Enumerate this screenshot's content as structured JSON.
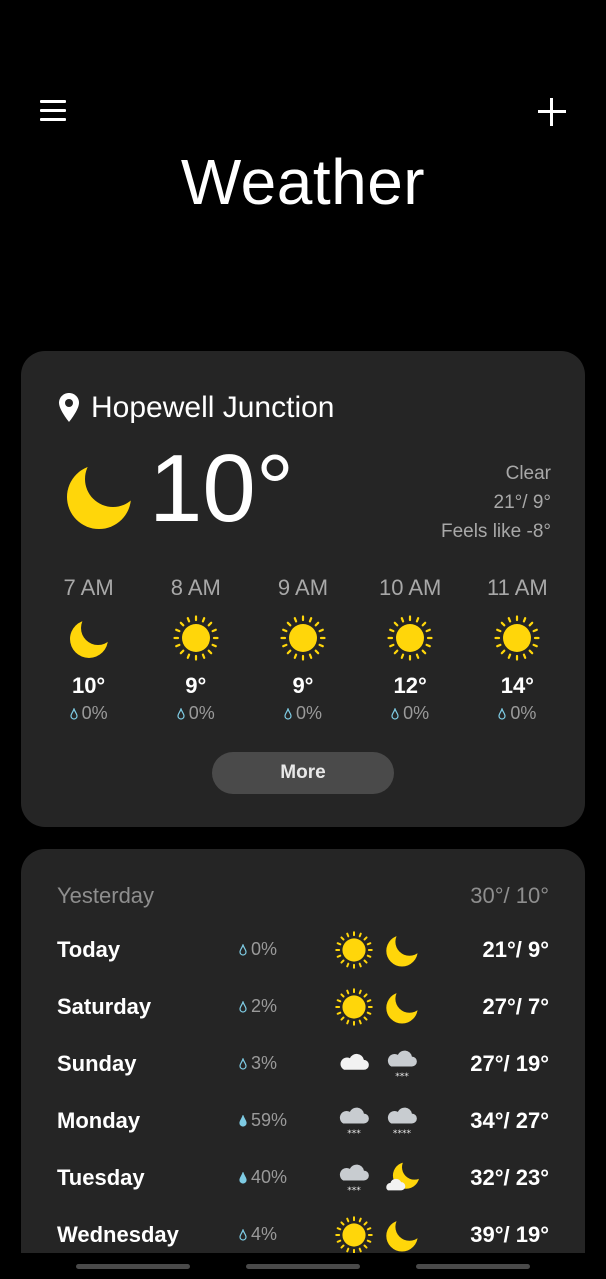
{
  "app": {
    "title": "Weather"
  },
  "current": {
    "location": "Hopewell Junction",
    "temp": "10°",
    "condition": "Clear",
    "high_low": "21°/ 9°",
    "feels_like": "Feels like -8°"
  },
  "hourly": [
    {
      "time": "7 AM",
      "icon": "moon-icon",
      "temp": "10°",
      "precip": "0%"
    },
    {
      "time": "8 AM",
      "icon": "sun-icon",
      "temp": "9°",
      "precip": "0%"
    },
    {
      "time": "9 AM",
      "icon": "sun-icon",
      "temp": "9°",
      "precip": "0%"
    },
    {
      "time": "10 AM",
      "icon": "sun-icon",
      "temp": "12°",
      "precip": "0%"
    },
    {
      "time": "11 AM",
      "icon": "sun-icon",
      "temp": "14°",
      "precip": "0%"
    }
  ],
  "more_label": "More",
  "daily": {
    "yesterday": {
      "label": "Yesterday",
      "temps": "30°/ 10°"
    },
    "days": [
      {
        "name": "Today",
        "precip": "0%",
        "icon_day": "sun-icon",
        "icon_night": "moon-icon",
        "temps": "21°/ 9°"
      },
      {
        "name": "Saturday",
        "precip": "2%",
        "icon_day": "sun-icon",
        "icon_night": "moon-icon",
        "temps": "27°/ 7°"
      },
      {
        "name": "Sunday",
        "precip": "3%",
        "icon_day": "cloud-icon",
        "icon_night": "snow-cloud-icon",
        "temps": "27°/ 19°"
      },
      {
        "name": "Monday",
        "precip": "59%",
        "icon_day": "snow-cloud-icon",
        "icon_night": "snow-cloud-icon",
        "temps": "34°/ 27°"
      },
      {
        "name": "Tuesday",
        "precip": "40%",
        "icon_day": "snow-cloud-icon",
        "icon_night": "partly-cloudy-night-icon",
        "temps": "32°/ 23°"
      },
      {
        "name": "Wednesday",
        "precip": "4%",
        "icon_day": "sun-icon",
        "icon_night": "moon-icon",
        "temps": "39°/ 19°"
      }
    ]
  },
  "colors": {
    "accent": "#FFD60A",
    "card": "#252525",
    "background": "#000000",
    "drop": "#7ecbe3"
  }
}
